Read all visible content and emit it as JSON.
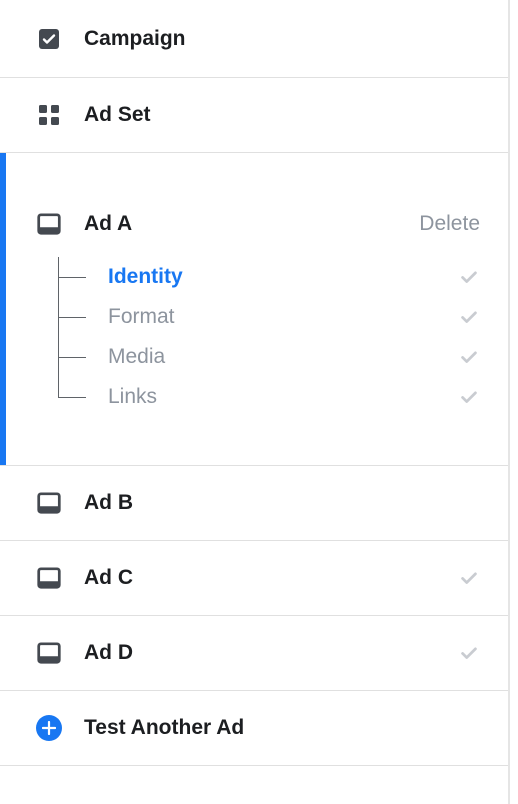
{
  "nav": {
    "campaign": "Campaign",
    "adset": "Ad Set"
  },
  "expanded_ad": {
    "title": "Ad A",
    "delete_label": "Delete",
    "sections": [
      {
        "label": "Identity",
        "active": true
      },
      {
        "label": "Format",
        "active": false
      },
      {
        "label": "Media",
        "active": false
      },
      {
        "label": "Links",
        "active": false
      }
    ]
  },
  "ads": [
    {
      "title": "Ad B",
      "complete": false
    },
    {
      "title": "Ad C",
      "complete": true
    },
    {
      "title": "Ad D",
      "complete": true
    }
  ],
  "test_label": "Test Another Ad",
  "colors": {
    "accent": "#1877f2",
    "text": "#1c1e21",
    "muted": "#8d949e",
    "check": "#c9ccd1",
    "border": "#e0e0e0"
  }
}
